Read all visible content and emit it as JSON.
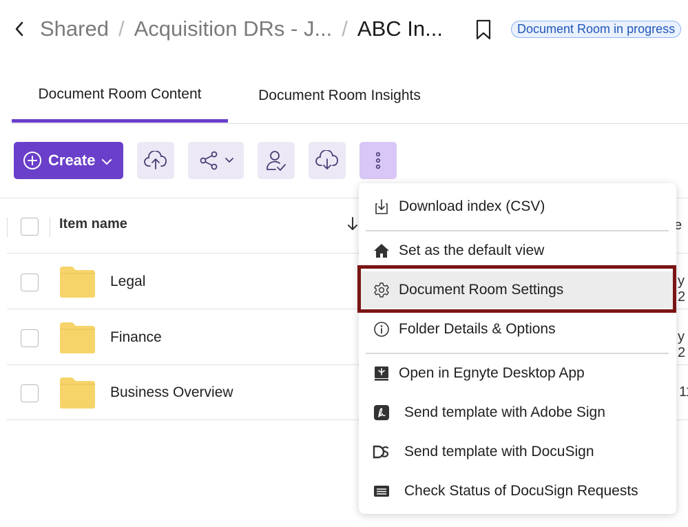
{
  "breadcrumb": {
    "items": [
      "Shared",
      "Acquisition DRs - J...",
      "ABC In..."
    ],
    "separator": "/"
  },
  "status_badge": "Document Room in progress",
  "tabs": [
    {
      "label": "Document Room Content",
      "active": true
    },
    {
      "label": "Document Room Insights",
      "active": false
    }
  ],
  "toolbar": {
    "create_label": "Create",
    "buttons": [
      "upload-icon",
      "share-icon",
      "assign-user-icon",
      "download-icon",
      "more-icon"
    ]
  },
  "table": {
    "column_header": "Item name",
    "rows": [
      {
        "name": "Legal",
        "right_text": "y 2"
      },
      {
        "name": "Finance",
        "right_text": "y 2"
      },
      {
        "name": "Business Overview",
        "right_text": "11"
      }
    ],
    "header_right_text": "e"
  },
  "menu": {
    "items": [
      {
        "label": "Download index (CSV)",
        "icon": "download-file-icon"
      },
      {
        "label": "Set as the default view",
        "icon": "home-icon"
      },
      {
        "label": "Document Room Settings",
        "icon": "gear-icon",
        "highlighted": true
      },
      {
        "label": "Folder Details & Options",
        "icon": "info-icon"
      },
      {
        "label": "Open in Egnyte Desktop App",
        "icon": "desktop-app-icon"
      },
      {
        "label": "Send template with Adobe Sign",
        "icon": "adobe-sign-icon"
      },
      {
        "label": "Send template with DocuSign",
        "icon": "docusign-icon"
      },
      {
        "label": "Check Status of DocuSign Requests",
        "icon": "list-icon"
      }
    ]
  },
  "colors": {
    "accent": "#6a3fc9",
    "toolbar_button_bg": "#ece8f6",
    "folder": "#f6d46a",
    "highlight_frame": "#7a1414"
  }
}
